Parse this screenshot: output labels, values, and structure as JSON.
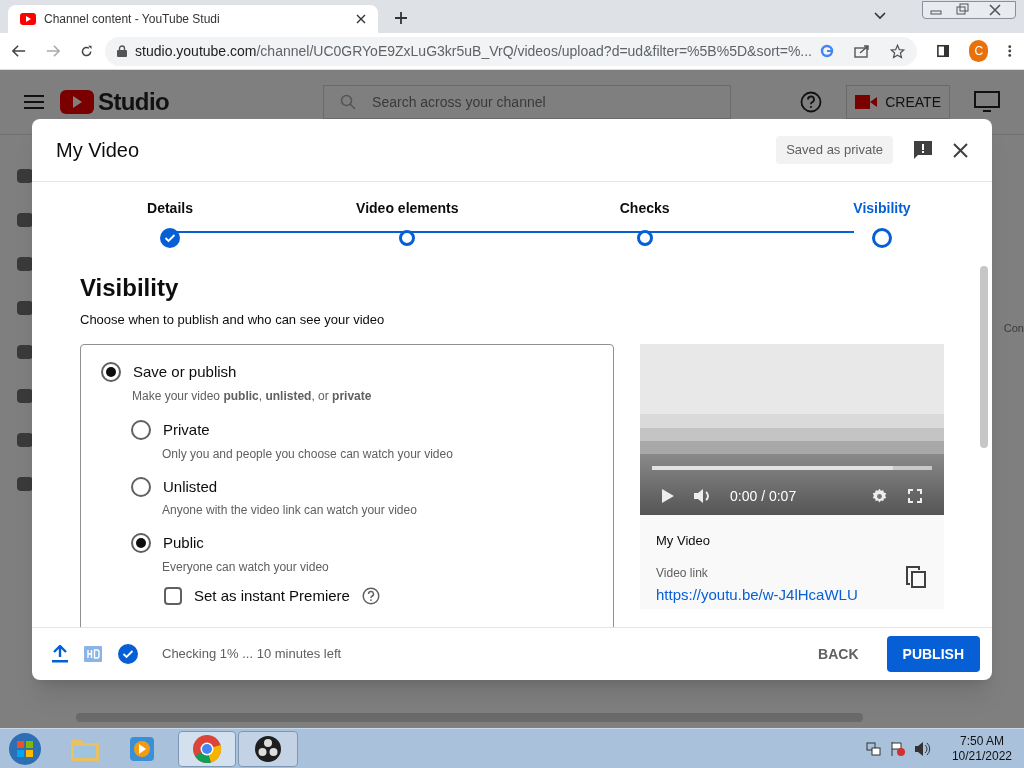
{
  "browser": {
    "tab_title": "Channel content - YouTube Studi",
    "url_host": "studio.youtube.com",
    "url_path": "/channel/UC0GRYoE9ZxLuG3kr5uB_VrQ/videos/upload?d=ud&filter=%5B%5D&sort=%...",
    "profile_initial": "C"
  },
  "studio": {
    "logo_text": "Studio",
    "search_placeholder": "Search across your channel",
    "create_label": "CREATE",
    "edge_text": "Con"
  },
  "dialog": {
    "title": "My Video",
    "save_status": "Saved as private",
    "steps": [
      {
        "label": "Details",
        "completed": true,
        "selected": false
      },
      {
        "label": "Video elements",
        "completed": false,
        "selected": false
      },
      {
        "label": "Checks",
        "completed": false,
        "selected": false
      },
      {
        "label": "Visibility",
        "completed": false,
        "selected": true
      }
    ],
    "heading": "Visibility",
    "subheading": "Choose when to publish and who can see your video",
    "save_option": {
      "label": "Save or publish",
      "description": "Make your video **public**, **unlisted**, or **private**",
      "selected": true
    },
    "options": [
      {
        "label": "Private",
        "description": "Only you and people you choose can watch your video",
        "selected": false
      },
      {
        "label": "Unlisted",
        "description": "Anyone with the video link can watch your video",
        "selected": false
      },
      {
        "label": "Public",
        "description": "Everyone can watch your video",
        "selected": true
      }
    ],
    "premiere": {
      "label": "Set as instant Premiere",
      "checked": false
    },
    "video": {
      "time": "0:00 / 0:07",
      "title": "My Video",
      "link_label": "Video link",
      "link": "https://youtu.be/w-J4lHcaWLU"
    },
    "footer": {
      "status": "Checking 1% ... 10 minutes left",
      "back": "BACK",
      "publish": "PUBLISH"
    }
  },
  "taskbar": {
    "time": "7:50 AM",
    "date": "10/21/2022"
  }
}
